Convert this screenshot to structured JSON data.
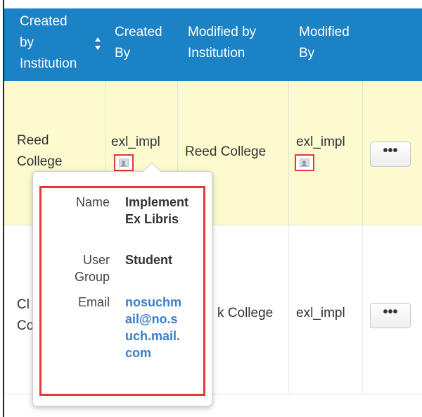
{
  "table": {
    "headers": [
      {
        "lines": [
          "Created",
          "by",
          "Institution"
        ]
      },
      {
        "lines": [
          "Created",
          "By"
        ]
      },
      {
        "lines": [
          "Modified by",
          "Institution"
        ]
      },
      {
        "lines": [
          "Modified",
          "By"
        ]
      }
    ],
    "rows": [
      {
        "created_by_institution": [
          "Reed",
          "College"
        ],
        "created_by": "exl_impl",
        "modified_by_institution": "Reed College",
        "modified_by": "exl_impl",
        "actions_label": "•••"
      },
      {
        "created_by_institution": [
          "Cl",
          "Co"
        ],
        "modified_by_institution": "k College",
        "modified_by": "exl_impl",
        "actions_label": "•••"
      }
    ]
  },
  "popover": {
    "name_label": "Name",
    "name_value": "Implement Ex Libris",
    "group_label": [
      "User",
      "Group"
    ],
    "group_value": "Student",
    "email_label": "Email",
    "email_value": "nosuchmail@no.such.mail.com"
  },
  "colors": {
    "header_bg": "#1b82c5",
    "highlight_row": "#fbfbcf",
    "annotation_red": "#e53935",
    "link_blue": "#3a7dc9"
  },
  "icons": {
    "sort": "sort-arrows-icon",
    "user_card": "user-card-icon",
    "more": "ellipsis-icon"
  }
}
